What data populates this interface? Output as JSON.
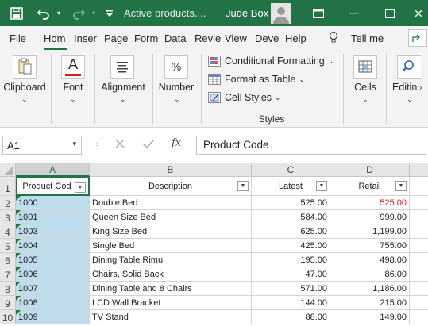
{
  "titlebar": {
    "doc_title": "Active products....",
    "user_name": "Jude Box"
  },
  "tabs": [
    "File",
    "Hom",
    "Inser",
    "Page",
    "Form",
    "Data",
    "Revie",
    "View",
    "Deve",
    "Help"
  ],
  "tell_me": "Tell me",
  "ribbon": {
    "clipboard": "Clipboard",
    "font": "Font",
    "alignment": "Alignment",
    "number": "Number",
    "conditional_formatting": "Conditional Formatting",
    "format_as_table": "Format as Table",
    "cell_styles": "Cell Styles",
    "styles_group": "Styles",
    "cells": "Cells",
    "editing": "Editin",
    "number_icon_glyph": "%",
    "font_icon_glyph": "A"
  },
  "formula_bar": {
    "name_box": "A1",
    "fx_label": "fx",
    "content": "Product Code"
  },
  "sheet": {
    "columns": [
      "A",
      "B",
      "C",
      "D"
    ],
    "row_numbers": [
      "1",
      "2",
      "3",
      "4",
      "5",
      "6",
      "7",
      "8",
      "9",
      "10"
    ],
    "headers": [
      "Product Cod",
      "Description",
      "Latest",
      "Retail"
    ],
    "rows": [
      [
        "1000",
        "Double Bed",
        "525.00",
        "525.00"
      ],
      [
        "1001",
        "Queen Size Bed",
        "584.00",
        "999.00"
      ],
      [
        "1003",
        "King Size Bed",
        "625.00",
        "1,199.00"
      ],
      [
        "1004",
        "Single Bed",
        "425.00",
        "755.00"
      ],
      [
        "1005",
        "Dining Table Rimu",
        "195.00",
        "498.00"
      ],
      [
        "1006",
        "Chairs, Solid Back",
        "47.00",
        "86.00"
      ],
      [
        "1007",
        "Dining Table and 8 Chairs",
        "571.00",
        "1,186.00"
      ],
      [
        "1008",
        "LCD Wall Bracket",
        "144.00",
        "215.00"
      ],
      [
        "1009",
        "TV Stand",
        "88.00",
        "149.00"
      ]
    ]
  },
  "colors": {
    "accent": "#217346",
    "selection_fill": "#bfdcec",
    "negative_red": "#e01b1b"
  }
}
